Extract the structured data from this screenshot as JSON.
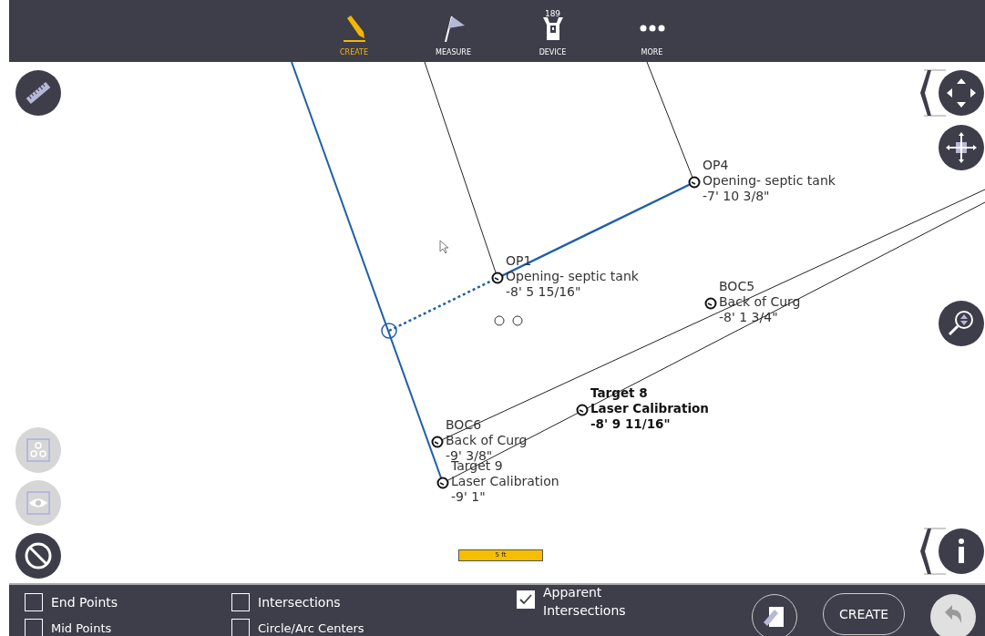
{
  "toolbar": {
    "items": [
      {
        "kind": "create",
        "label": "CREATE",
        "selected": true
      },
      {
        "kind": "measure",
        "label": "MEASURE",
        "selected": false
      },
      {
        "kind": "device",
        "label": "DEVICE",
        "selected": false,
        "badge": "189"
      },
      {
        "kind": "more",
        "label": "MORE",
        "selected": false
      }
    ]
  },
  "canvas": {
    "points": [
      {
        "name": "OP4",
        "description": "Opening- septic tank",
        "elevation": "-7' 10 3/8\""
      },
      {
        "name": "OP1",
        "description": "Opening- septic tank",
        "elevation": "-8' 5 15/16\""
      },
      {
        "name": "BOC5",
        "description": "Back of Curg",
        "elevation": "-8' 1 3/4\""
      },
      {
        "name": "Target 8",
        "description": "Laser Calibration",
        "elevation": "-8' 9 11/16\""
      },
      {
        "name": "BOC6",
        "description": "Back of Curg",
        "elevation": "-9' 3/8\""
      },
      {
        "name": "Target 9",
        "description": "Laser Calibration",
        "elevation": "-9' 1\""
      }
    ],
    "scale_bar": {
      "label": "5 ft"
    }
  },
  "side_tools": [
    {
      "kind": "ruler",
      "disabled": false
    },
    {
      "kind": "snap",
      "disabled": true
    },
    {
      "kind": "view",
      "disabled": true
    },
    {
      "kind": "cancel",
      "disabled": false
    }
  ],
  "nav_tools": [
    {
      "kind": "pan"
    },
    {
      "kind": "move"
    },
    {
      "kind": "zoom"
    },
    {
      "kind": "info"
    }
  ],
  "snaps": [
    {
      "label": "End Points",
      "checked": false
    },
    {
      "label": "Intersections",
      "checked": false
    },
    {
      "label": "Apparent Intersections",
      "checked": true
    },
    {
      "label": "Mid Points",
      "checked": false
    },
    {
      "label": "Circle/Arc Centers",
      "checked": false
    }
  ],
  "actions": {
    "create_label": "CREATE",
    "undo_disabled": true
  }
}
